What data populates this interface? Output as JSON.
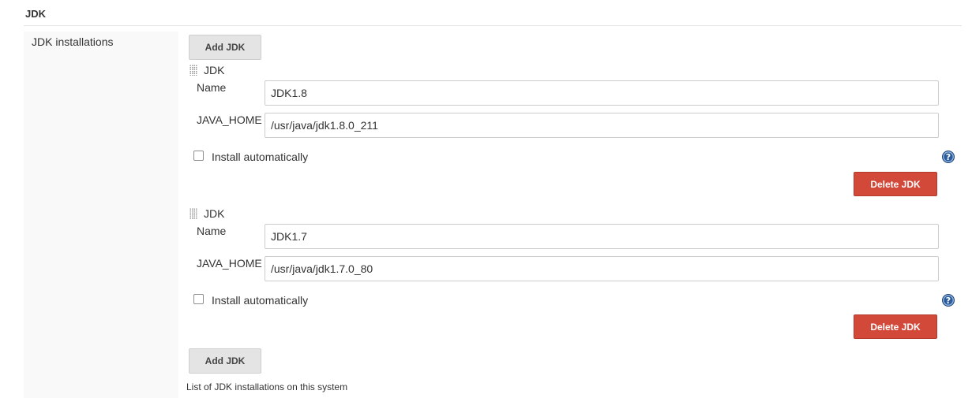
{
  "section": {
    "title": "JDK",
    "field_label": "JDK installations",
    "add_button_label": "Add JDK",
    "description": "List of JDK installations on this system"
  },
  "installations": [
    {
      "header": "JDK",
      "name_label": "Name",
      "name_value": "JDK1.8",
      "home_label": "JAVA_HOME",
      "home_value": "/usr/java/jdk1.8.0_211",
      "install_auto_label": "Install automatically",
      "install_auto_checked": false,
      "help_glyph": "?",
      "delete_label": "Delete JDK"
    },
    {
      "header": "JDK",
      "name_label": "Name",
      "name_value": "JDK1.7",
      "home_label": "JAVA_HOME",
      "home_value": "/usr/java/jdk1.7.0_80",
      "install_auto_label": "Install automatically",
      "install_auto_checked": false,
      "help_glyph": "?",
      "delete_label": "Delete JDK"
    }
  ],
  "colors": {
    "delete_button": "#d24939",
    "help_icon": "#2a5b9b",
    "secondary_button": "#e4e4e4"
  },
  "icons": {
    "drag_handle": "drag-handle-icon",
    "help": "help-icon"
  }
}
